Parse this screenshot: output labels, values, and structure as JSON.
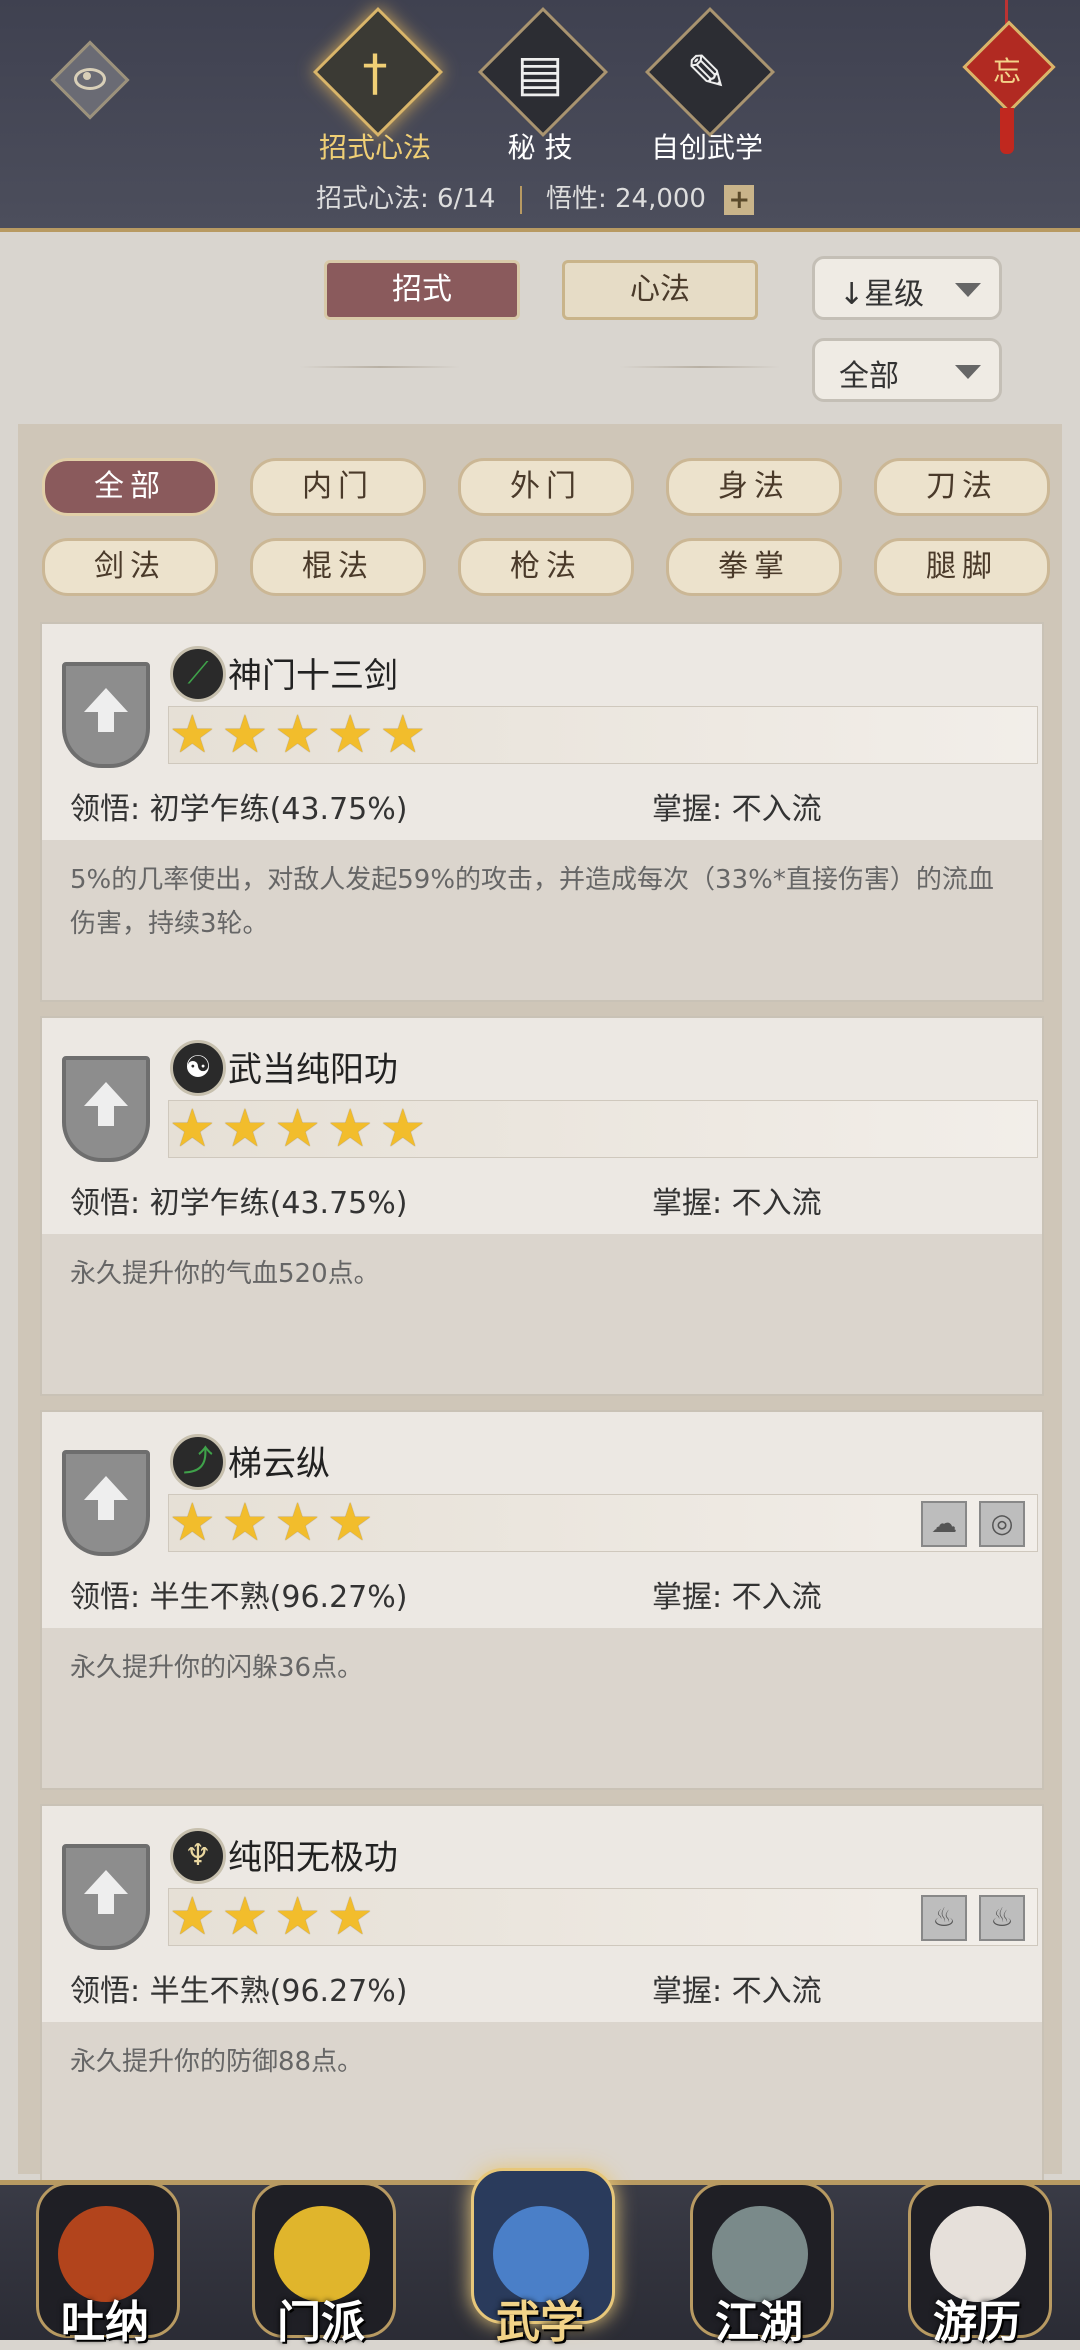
{
  "header": {
    "tabs": [
      {
        "label": "招式心法",
        "icon": "sword-icon",
        "glyph": "†",
        "active": true
      },
      {
        "label": "秘 技",
        "icon": "book-icon",
        "glyph": "▤",
        "active": false
      },
      {
        "label": "自创武学",
        "icon": "scroll-icon",
        "glyph": "✎",
        "active": false
      }
    ],
    "stats": {
      "progress_label": "招式心法:",
      "progress_value": "6/14",
      "insight_label": "悟性:",
      "insight_value": "24,000"
    },
    "charm_text": "忘"
  },
  "filters": {
    "type_buttons": [
      {
        "label": "招式",
        "selected": true
      },
      {
        "label": "心法",
        "selected": false
      }
    ],
    "sort": {
      "value": "↓星级"
    },
    "scope": {
      "value": "全部"
    }
  },
  "categories": [
    {
      "label": "全部",
      "selected": true
    },
    {
      "label": "内门",
      "selected": false
    },
    {
      "label": "外门",
      "selected": false
    },
    {
      "label": "身法",
      "selected": false
    },
    {
      "label": "刀法",
      "selected": false
    },
    {
      "label": "剑法",
      "selected": false
    },
    {
      "label": "棍法",
      "selected": false
    },
    {
      "label": "枪法",
      "selected": false
    },
    {
      "label": "拳掌",
      "selected": false
    },
    {
      "label": "腿脚",
      "selected": false
    }
  ],
  "skills": [
    {
      "name": "神门十三剑",
      "icon": "sword-skill-icon",
      "icon_glyph": "⟋",
      "icon_color": "#3fa24a",
      "stars": 5,
      "comprehension_label": "领悟:",
      "comprehension": "初学乍练(43.75%)",
      "mastery_label": "掌握:",
      "mastery": "不入流",
      "description": "5%的几率使出，对敌人发起59%的攻击，并造成每次（33%*直接伤害）的流血伤害，持续3轮。",
      "elements": []
    },
    {
      "name": "武当纯阳功",
      "icon": "yin-yang-icon",
      "icon_glyph": "☯",
      "icon_color": "#ffffff",
      "stars": 5,
      "comprehension_label": "领悟:",
      "comprehension": "初学乍练(43.75%)",
      "mastery_label": "掌握:",
      "mastery": "不入流",
      "description": "永久提升你的气血520点。",
      "elements": []
    },
    {
      "name": "梯云纵",
      "icon": "boot-icon",
      "icon_glyph": "⤴",
      "icon_color": "#3fa24a",
      "stars": 4,
      "comprehension_label": "领悟:",
      "comprehension": "半生不熟(96.27%)",
      "mastery_label": "掌握:",
      "mastery": "不入流",
      "description": "永久提升你的闪躲36点。",
      "elements": [
        {
          "icon": "cloud-icon",
          "glyph": "☁"
        },
        {
          "icon": "wind-icon",
          "glyph": "◎"
        }
      ]
    },
    {
      "name": "纯阳无极功",
      "icon": "meditation-icon",
      "icon_glyph": "♆",
      "icon_color": "#e9d7a0",
      "stars": 4,
      "comprehension_label": "领悟:",
      "comprehension": "半生不熟(96.27%)",
      "mastery_label": "掌握:",
      "mastery": "不入流",
      "description": "永久提升你的防御88点。",
      "elements": [
        {
          "icon": "fire-icon",
          "glyph": "♨"
        },
        {
          "icon": "flame-icon",
          "glyph": "♨"
        }
      ]
    }
  ],
  "bottom_nav": [
    {
      "label": "吐纳",
      "icon": "monk-icon",
      "art_color": "#b2441c",
      "active": false
    },
    {
      "label": "门派",
      "icon": "banner-icon",
      "art_color": "#e0b52c",
      "active": false
    },
    {
      "label": "武学",
      "icon": "book-icon",
      "art_color": "#4a7fc8",
      "active": true
    },
    {
      "label": "江湖",
      "icon": "hat-icon",
      "art_color": "#7a8a8a",
      "active": false
    },
    {
      "label": "游历",
      "icon": "horse-icon",
      "art_color": "#e6e0da",
      "active": false
    }
  ]
}
